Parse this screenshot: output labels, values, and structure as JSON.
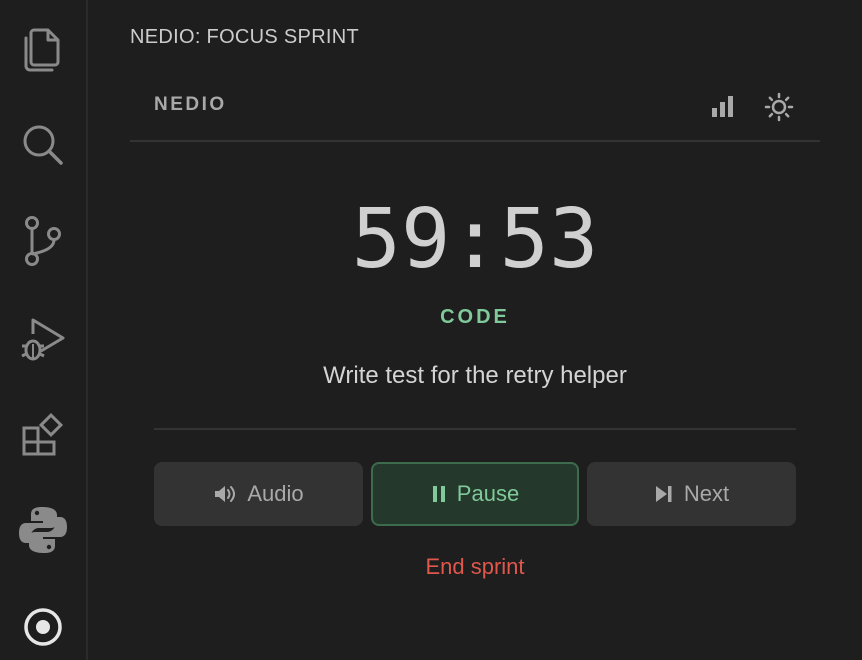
{
  "activity_bar": {
    "items": [
      {
        "icon": "files-icon"
      },
      {
        "icon": "search-icon"
      },
      {
        "icon": "source-control-icon"
      },
      {
        "icon": "run-debug-icon"
      },
      {
        "icon": "extensions-icon"
      },
      {
        "icon": "python-icon"
      },
      {
        "icon": "nedio-target-icon"
      }
    ]
  },
  "panel": {
    "title": "NEDIO: FOCUS SPRINT",
    "brand": "NEDIO",
    "header_icons": [
      "stats-bar-chart-icon",
      "theme-sun-icon"
    ]
  },
  "timer": {
    "display": "59:53",
    "mode": "CODE",
    "task": "Write test for the retry helper"
  },
  "controls": {
    "audio_label": "Audio",
    "pause_label": "Pause",
    "next_label": "Next",
    "end_label": "End sprint"
  },
  "colors": {
    "background": "#1e1e1e",
    "mode_accent": "#7fc99a",
    "pause_bg": "#24392c",
    "pause_border": "#3d6b4e",
    "end_red": "#e0574c",
    "button_bg": "#333333"
  }
}
